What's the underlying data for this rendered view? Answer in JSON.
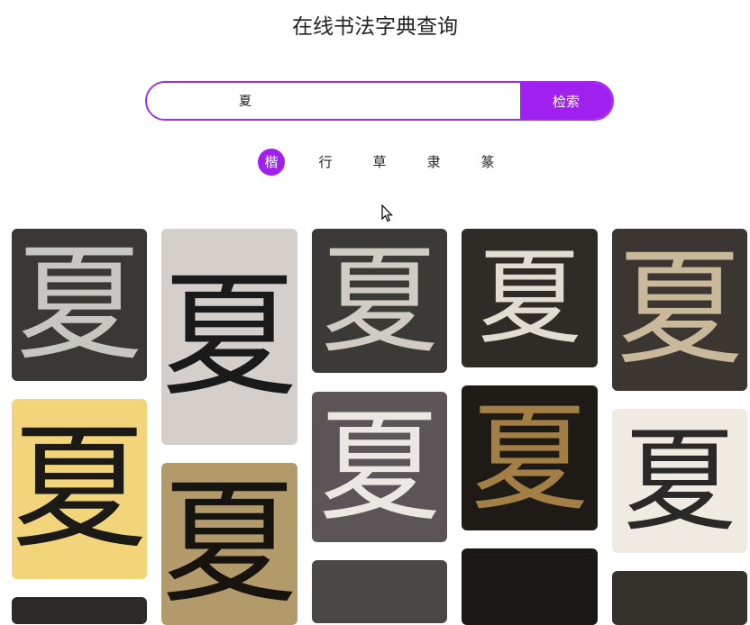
{
  "header": {
    "title": "在线书法字典查询"
  },
  "search": {
    "value": "夏",
    "button_label": "检索"
  },
  "script_styles": [
    {
      "label": "楷",
      "active": true
    },
    {
      "label": "行",
      "active": false
    },
    {
      "label": "草",
      "active": false
    },
    {
      "label": "隶",
      "active": false
    },
    {
      "label": "篆",
      "active": false
    }
  ],
  "results": {
    "char": "夏"
  },
  "colors": {
    "accent": "#a020f0"
  }
}
